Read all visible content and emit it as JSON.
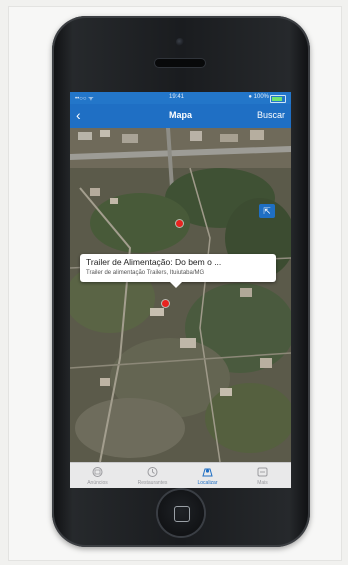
{
  "statusbar": {
    "carrier": "••○○ ᯤ",
    "time": "19:41",
    "battery": "● 100%"
  },
  "navbar": {
    "back_label": "‹",
    "title": "Mapa",
    "right_label": "Buscar"
  },
  "callout": {
    "title": "Trailer de Alimentação: Do bem o ...",
    "subtitle": "Trailer de alimentação Trailers, Ituiutaba/MG"
  },
  "location_button_icon": "location-arrow-icon",
  "tabs": [
    {
      "label": "Anúncios",
      "icon": "megaphone-icon",
      "active": false
    },
    {
      "label": "Restaurantes",
      "icon": "clock-icon",
      "active": false
    },
    {
      "label": "Localizar",
      "icon": "map-pin-icon",
      "active": true
    },
    {
      "label": "Mais",
      "icon": "more-icon",
      "active": false
    }
  ],
  "colors": {
    "accent": "#1f6fc4",
    "pin": "#e8231f"
  }
}
